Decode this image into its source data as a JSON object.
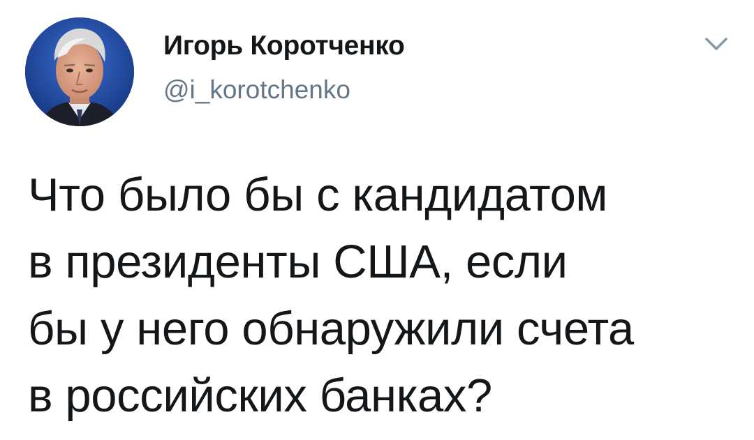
{
  "author": {
    "display_name": "Игорь Коротченко",
    "handle": "@i_korotchenko",
    "avatar_icon": "user-portrait-avatar"
  },
  "menu": {
    "icon": "chevron-down-icon"
  },
  "tweet": {
    "text": "Что было бы с кандидатом\nв президенты США, если\nбы у него обнаружили счета\nв российских банках?"
  },
  "colors": {
    "text": "#14171a",
    "secondary_text": "#657786",
    "caret": "#8899a6",
    "avatar_background": "#1b3f8a"
  }
}
